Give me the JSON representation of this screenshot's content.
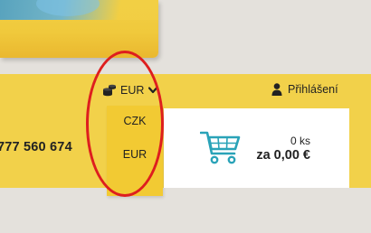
{
  "header": {
    "currency": {
      "selected": "EUR",
      "icon": "coins-icon",
      "options": [
        "CZK",
        "EUR"
      ]
    },
    "login_label": "Přihlášení"
  },
  "contact": {
    "phone": "777 560 674"
  },
  "cart": {
    "quantity": "0 ks",
    "total": "za 0,00 €",
    "icon": "shopping-cart-icon"
  },
  "colors": {
    "brand_yellow": "#f2d14a",
    "dropdown_yellow": "#f2ca33",
    "cart_teal": "#2aa3b8",
    "annotation_red": "#de1e1e"
  }
}
